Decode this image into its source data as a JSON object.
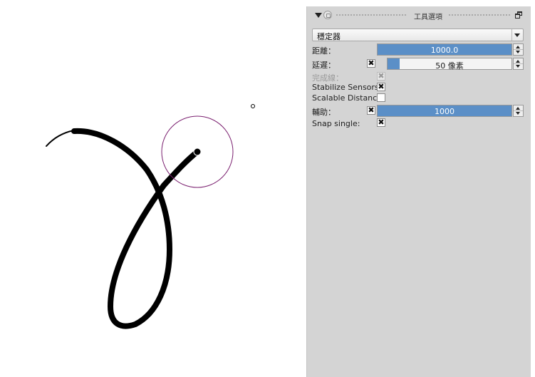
{
  "panel": {
    "title": "工具選項",
    "mode_select": {
      "value": "穩定器"
    },
    "rows": {
      "distance": {
        "label": "距離：",
        "value": "1000.0",
        "fill": 1.0
      },
      "delay": {
        "label": "延遲：",
        "checked": true,
        "value": "50 像素",
        "fill": 0.1
      },
      "finish_line": {
        "label": "完成線：",
        "checked": true,
        "disabled": true
      },
      "stabilize_sensors": {
        "label": "Stabilize Sensors:",
        "checked": true
      },
      "scalable_distance": {
        "label": "Scalable Distance:",
        "checked": false
      },
      "assist": {
        "label": "輔助：",
        "checked": true,
        "value": "1000",
        "fill": 1.0
      },
      "snap_single": {
        "label": "Snap single:",
        "checked": true
      }
    }
  },
  "colors": {
    "slider_fill": "#5b8fc7",
    "panel_bg": "#d4d4d4",
    "stroke": "#000000",
    "stabilizer_circle": "#7a1f6f"
  },
  "icons": {
    "collapse": "triangle-down-icon",
    "lock": "lock-circle-icon",
    "float": "float-window-icon",
    "check": "x-mark-icon"
  }
}
